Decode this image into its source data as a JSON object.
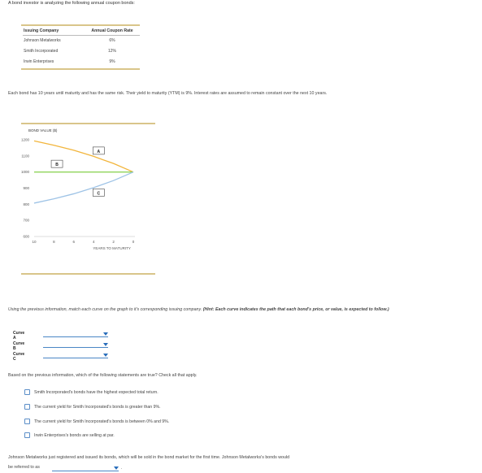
{
  "intro": "A bond investor is analyzing the following annual coupon bonds:",
  "table": {
    "headers": [
      "Issuing Company",
      "Annual Coupon Rate"
    ],
    "rows": [
      [
        "Johnson Metalworks",
        "6%"
      ],
      [
        "Smith Incorporated",
        "12%"
      ],
      [
        "Irwin Enterprises",
        "9%"
      ]
    ]
  },
  "description": "Each bond has 10 years until maturity and has the same risk. Their yield to maturity (YTM) is 9%. Interest rates are assumed to remain constant over the next 10 years.",
  "chart_data": {
    "type": "line",
    "ylabel": "BOND VALUE ($)",
    "xlabel": "YEARS TO MATURITY",
    "x": [
      10,
      8,
      6,
      4,
      2,
      0
    ],
    "ylim": [
      600,
      1200
    ],
    "yticks": [
      1200,
      1100,
      1000,
      900,
      800,
      700,
      600
    ],
    "series": [
      {
        "name": "A",
        "color": "#f2b53c",
        "values": [
          1193,
          1166,
          1135,
          1097,
          1053,
          1000
        ]
      },
      {
        "name": "B",
        "color": "#8fd45a",
        "values": [
          1000,
          1000,
          1000,
          1000,
          1000,
          1000
        ]
      },
      {
        "name": "C",
        "color": "#9ec3e6",
        "values": [
          807,
          834,
          865,
          903,
          947,
          1000
        ]
      }
    ]
  },
  "match_prompt": "Using the previous information, match each curve on the graph to it's corresponding issuing company. ",
  "match_hint": "(Hint: Each curve indicates the path that each bond's price, or value, is expected to follow.)",
  "curves": [
    {
      "label": "Curve A",
      "value": ""
    },
    {
      "label": "Curve B",
      "value": ""
    },
    {
      "label": "Curve C",
      "value": ""
    }
  ],
  "statements_prompt": "Based on the previous information, which of the following statements are true? Check all that apply.",
  "statements": [
    "Smith Incorporated's bonds have the highest expected total return.",
    "The current yield for Smith Incorporated's bonds is greater than 9%.",
    "The current yield for Smith Incorporated's bonds is between 0% and 9%.",
    "Irwin Enterprises's bonds are selling at par."
  ],
  "johnson_text": "Johnson Metalworks just registered and issued its bonds, which will be sold in the bond market for the first time. Johnson Metalworks's bonds would",
  "johnson_text2": "be referred to as",
  "johnson_value": "",
  "colors": {
    "rule": "#d9c58a",
    "dropdown": "#2a6ebb",
    "checkbox": "#5b8ec8"
  }
}
